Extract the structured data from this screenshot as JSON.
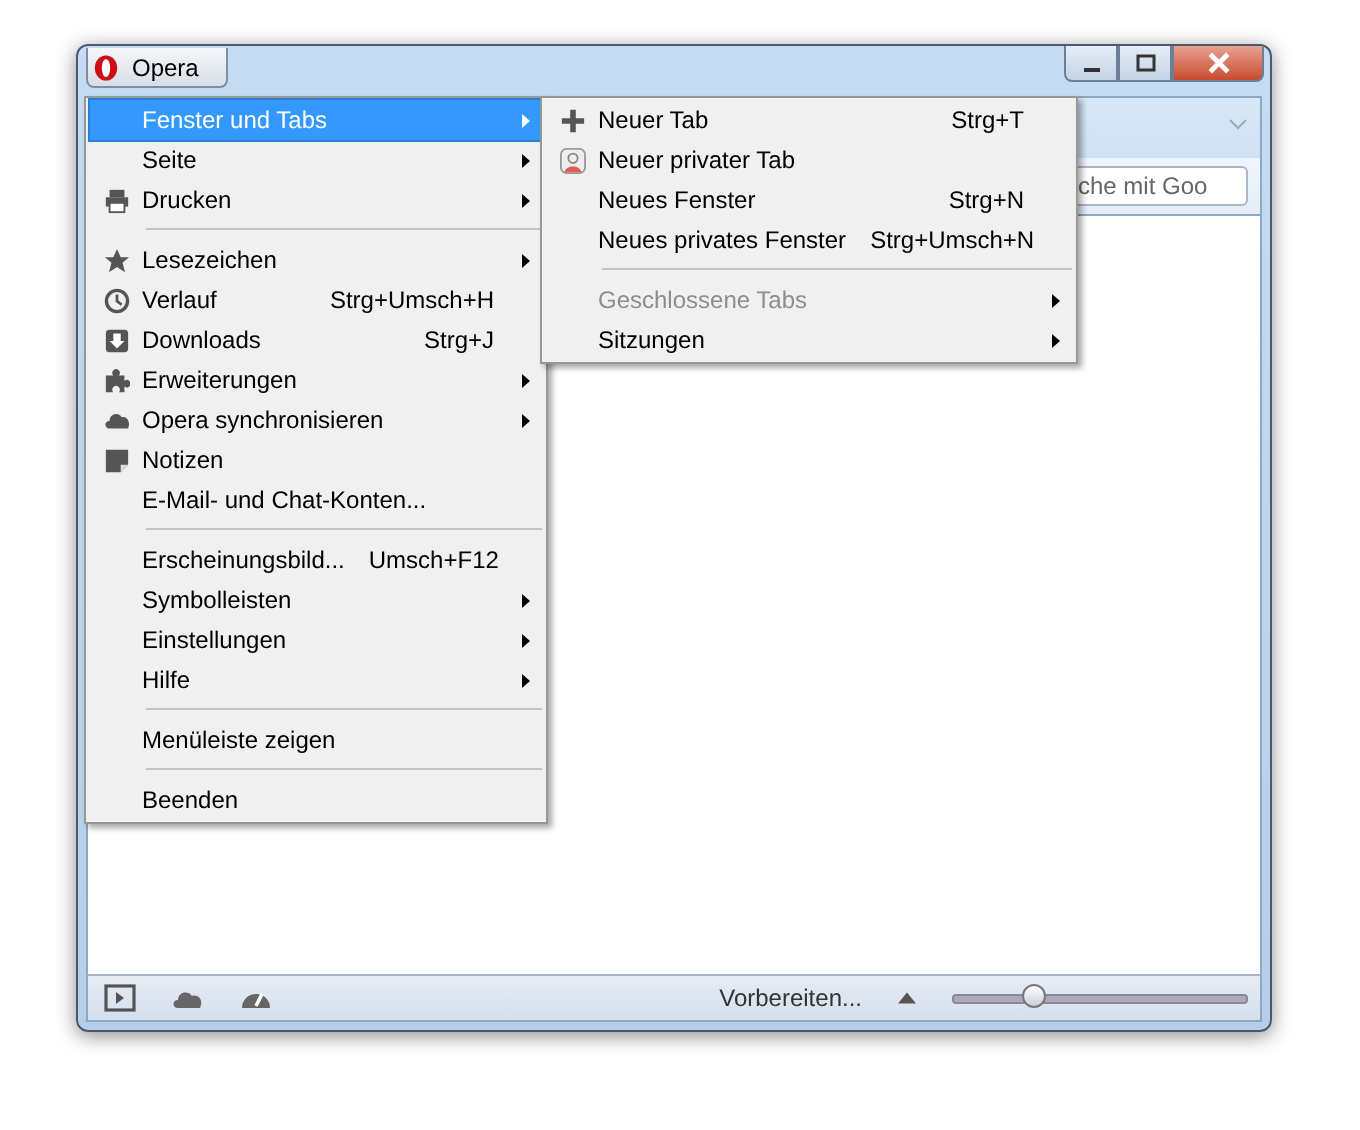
{
  "window": {
    "app_button": "Opera"
  },
  "toolbar": {
    "search": {
      "placeholder": "che mit Goo"
    }
  },
  "menu": {
    "items": [
      {
        "kind": "item",
        "label": "Fenster und Tabs",
        "submenu": true,
        "selected": true
      },
      {
        "kind": "item",
        "label": "Seite",
        "submenu": true,
        "selected": false
      },
      {
        "kind": "item",
        "label": "Drucken",
        "submenu": true,
        "selected": false
      },
      {
        "kind": "separator"
      },
      {
        "kind": "item",
        "label": "Lesezeichen",
        "submenu": true,
        "selected": false
      },
      {
        "kind": "item",
        "label": "Verlauf",
        "shortcut": "Strg+Umsch+H",
        "submenu": false,
        "selected": false
      },
      {
        "kind": "item",
        "label": "Downloads",
        "shortcut": "Strg+J",
        "submenu": false,
        "selected": false
      },
      {
        "kind": "item",
        "label": "Erweiterungen",
        "submenu": true,
        "selected": false
      },
      {
        "kind": "item",
        "label": "Opera synchronisieren",
        "submenu": true,
        "selected": false
      },
      {
        "kind": "item",
        "label": "Notizen",
        "submenu": false,
        "selected": false
      },
      {
        "kind": "item",
        "label": "E-Mail- und Chat-Konten...",
        "submenu": false,
        "selected": false
      },
      {
        "kind": "separator"
      },
      {
        "kind": "item",
        "label": "Erscheinungsbild...",
        "shortcut": "Umsch+F12",
        "submenu": false,
        "selected": false
      },
      {
        "kind": "item",
        "label": "Symbolleisten",
        "submenu": true,
        "selected": false
      },
      {
        "kind": "item",
        "label": "Einstellungen",
        "submenu": true,
        "selected": false
      },
      {
        "kind": "item",
        "label": "Hilfe",
        "submenu": true,
        "selected": false
      },
      {
        "kind": "separator"
      },
      {
        "kind": "item",
        "label": "Menüleiste zeigen",
        "submenu": false,
        "selected": false
      },
      {
        "kind": "separator"
      },
      {
        "kind": "item",
        "label": "Beenden",
        "submenu": false,
        "selected": false
      }
    ]
  },
  "submenu": {
    "items": [
      {
        "kind": "item",
        "label": "Neuer Tab",
        "shortcut": "Strg+T",
        "submenu": false,
        "disabled": false
      },
      {
        "kind": "item",
        "label": "Neuer privater Tab",
        "submenu": false,
        "disabled": false
      },
      {
        "kind": "item",
        "label": "Neues Fenster",
        "shortcut": "Strg+N",
        "submenu": false,
        "disabled": false
      },
      {
        "kind": "item",
        "label": "Neues privates Fenster",
        "shortcut": "Strg+Umsch+N",
        "submenu": false,
        "disabled": false
      },
      {
        "kind": "separator"
      },
      {
        "kind": "item",
        "label": "Geschlossene Tabs",
        "submenu": true,
        "disabled": true
      },
      {
        "kind": "item",
        "label": "Sitzungen",
        "submenu": true,
        "disabled": false
      }
    ]
  },
  "status_bar": {
    "text": "Vorbereiten...",
    "zoom": {
      "level": 0.28
    }
  }
}
